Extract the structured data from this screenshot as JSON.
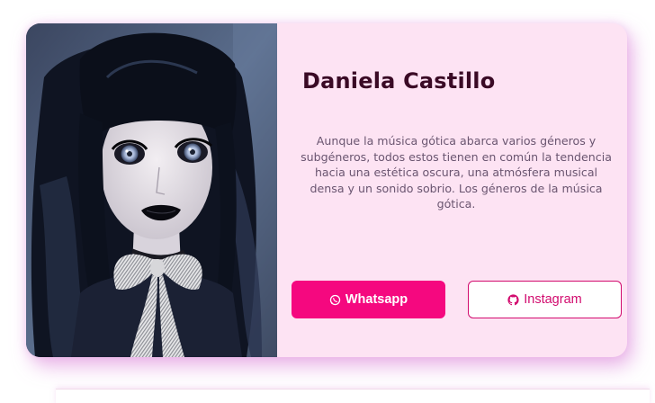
{
  "profile": {
    "name": "Daniela Castillo",
    "bio": "Aunque la música gótica abarca varios géneros y subgéneros, todos estos tienen en común la tendencia hacia una estética oscura, una atmósfera musical densa y un sonido sobrio. Los géneros de la música gótica.",
    "photo_description": "portrait"
  },
  "buttons": {
    "whatsapp": {
      "label": "Whatsapp",
      "icon": "whatsapp-icon"
    },
    "instagram": {
      "label": "Instagram",
      "icon": "github-icon"
    }
  },
  "colors": {
    "card_background": "#fde3f3",
    "name_text": "#3a0a25",
    "bio_text": "#6a5570",
    "primary": "#f5087f",
    "outline": "#d20b6e",
    "shadow": "#e29be0"
  }
}
